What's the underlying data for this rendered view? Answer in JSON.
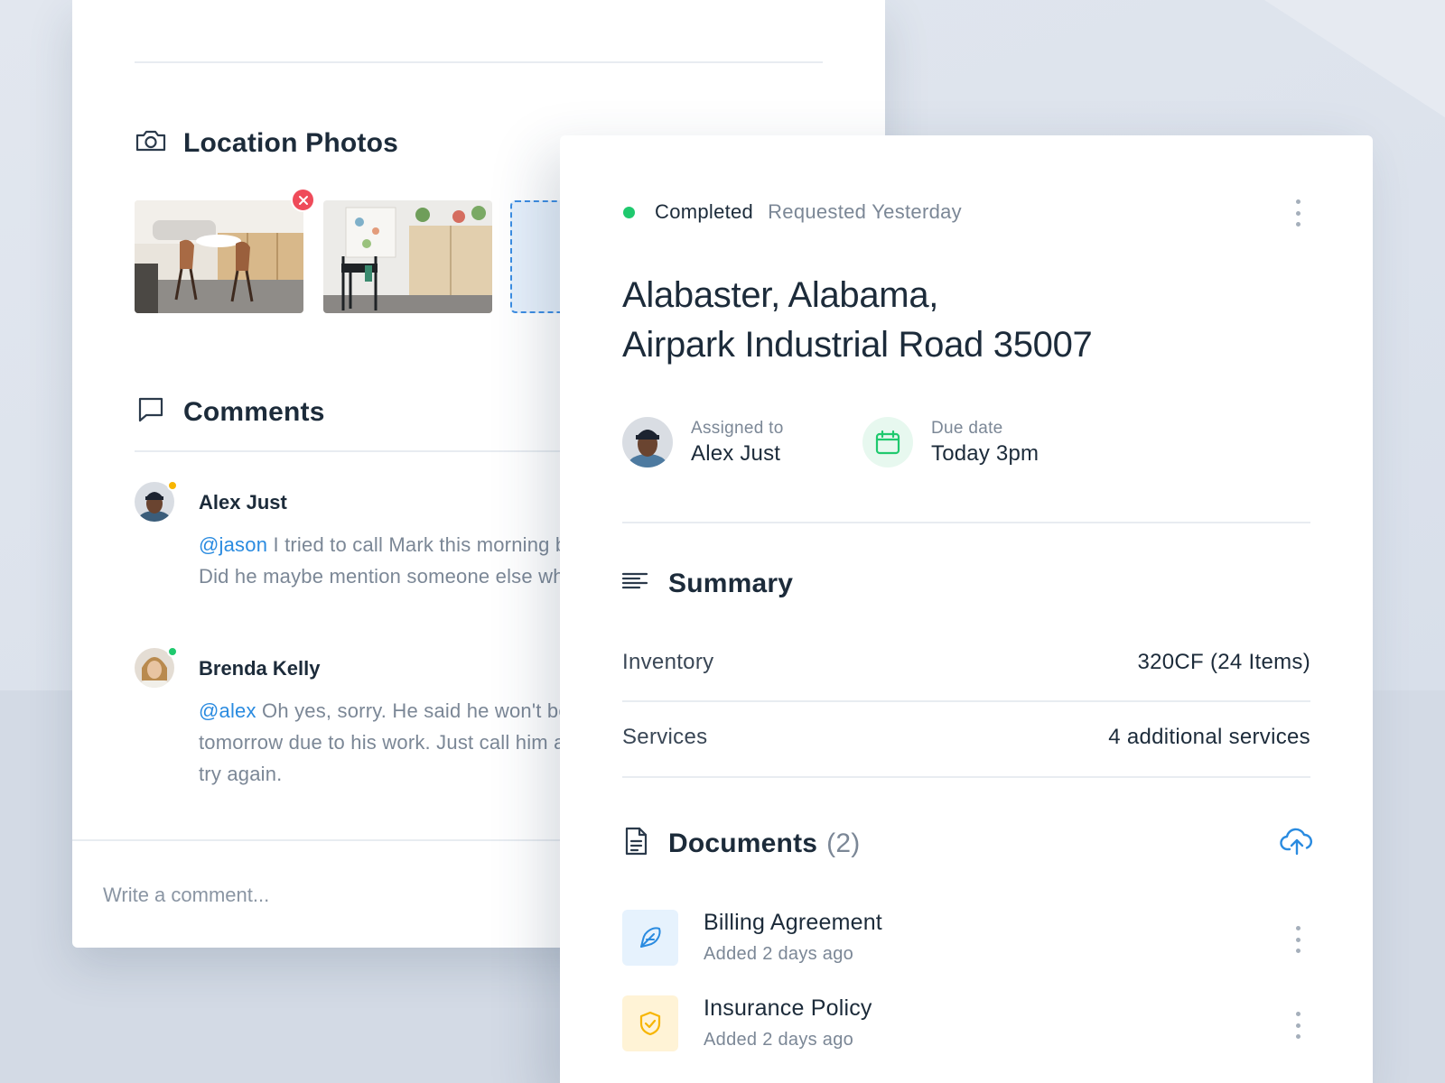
{
  "background": {
    "top": "#e2e7ef",
    "bottom": "#d3dae5"
  },
  "colors": {
    "accent": "#2a8be0",
    "success": "#1fc96e",
    "danger": "#ef4b5a",
    "warning": "#f7b500",
    "text": "#1c2b3a",
    "muted": "#7b8796"
  },
  "details_panel": {
    "location_photos": {
      "title": "Location Photos",
      "icon": "camera-icon",
      "photo_count": 2
    },
    "comments": {
      "title": "Comments",
      "icon": "comment-icon",
      "items": [
        {
          "author": "Alex Just",
          "presence": "away",
          "mention": "@jason",
          "text": " I tried to call Mark this morning but got no response. Did he maybe mention someone else who is available?"
        },
        {
          "author": "Brenda Kelly",
          "presence": "online",
          "mention": "@alex",
          "text": " Oh yes, sorry. He said he won't be available until tomorrow due to his work. Just call him again tomorrow and try again."
        }
      ]
    },
    "comment_input": {
      "placeholder": "Write a comment...",
      "value": ""
    }
  },
  "order": {
    "status": "Completed",
    "requested": "Requested Yesterday",
    "address_line1": "Alabaster, Alabama,",
    "address_line2": "Airpark Industrial Road 35007",
    "assigned": {
      "label": "Assigned to",
      "name": "Alex Just"
    },
    "due": {
      "label": "Due date",
      "value": "Today 3pm",
      "icon": "calendar-icon"
    },
    "summary": {
      "title": "Summary",
      "icon": "text-lines-icon",
      "rows": [
        {
          "label": "Inventory",
          "value": "320CF (24 Items)"
        },
        {
          "label": "Services",
          "value": "4 additional services"
        }
      ]
    },
    "documents": {
      "title": "Documents",
      "count": "(2)",
      "icon": "document-icon",
      "upload_icon": "cloud-upload-icon",
      "items": [
        {
          "name": "Billing Agreement",
          "added": "Added 2 days ago",
          "icon": "feather-icon",
          "tint": "#e6f2fd"
        },
        {
          "name": "Insurance Policy",
          "added": "Added 2 days ago",
          "icon": "shield-check-icon",
          "tint": "#fff3d6"
        }
      ]
    }
  }
}
